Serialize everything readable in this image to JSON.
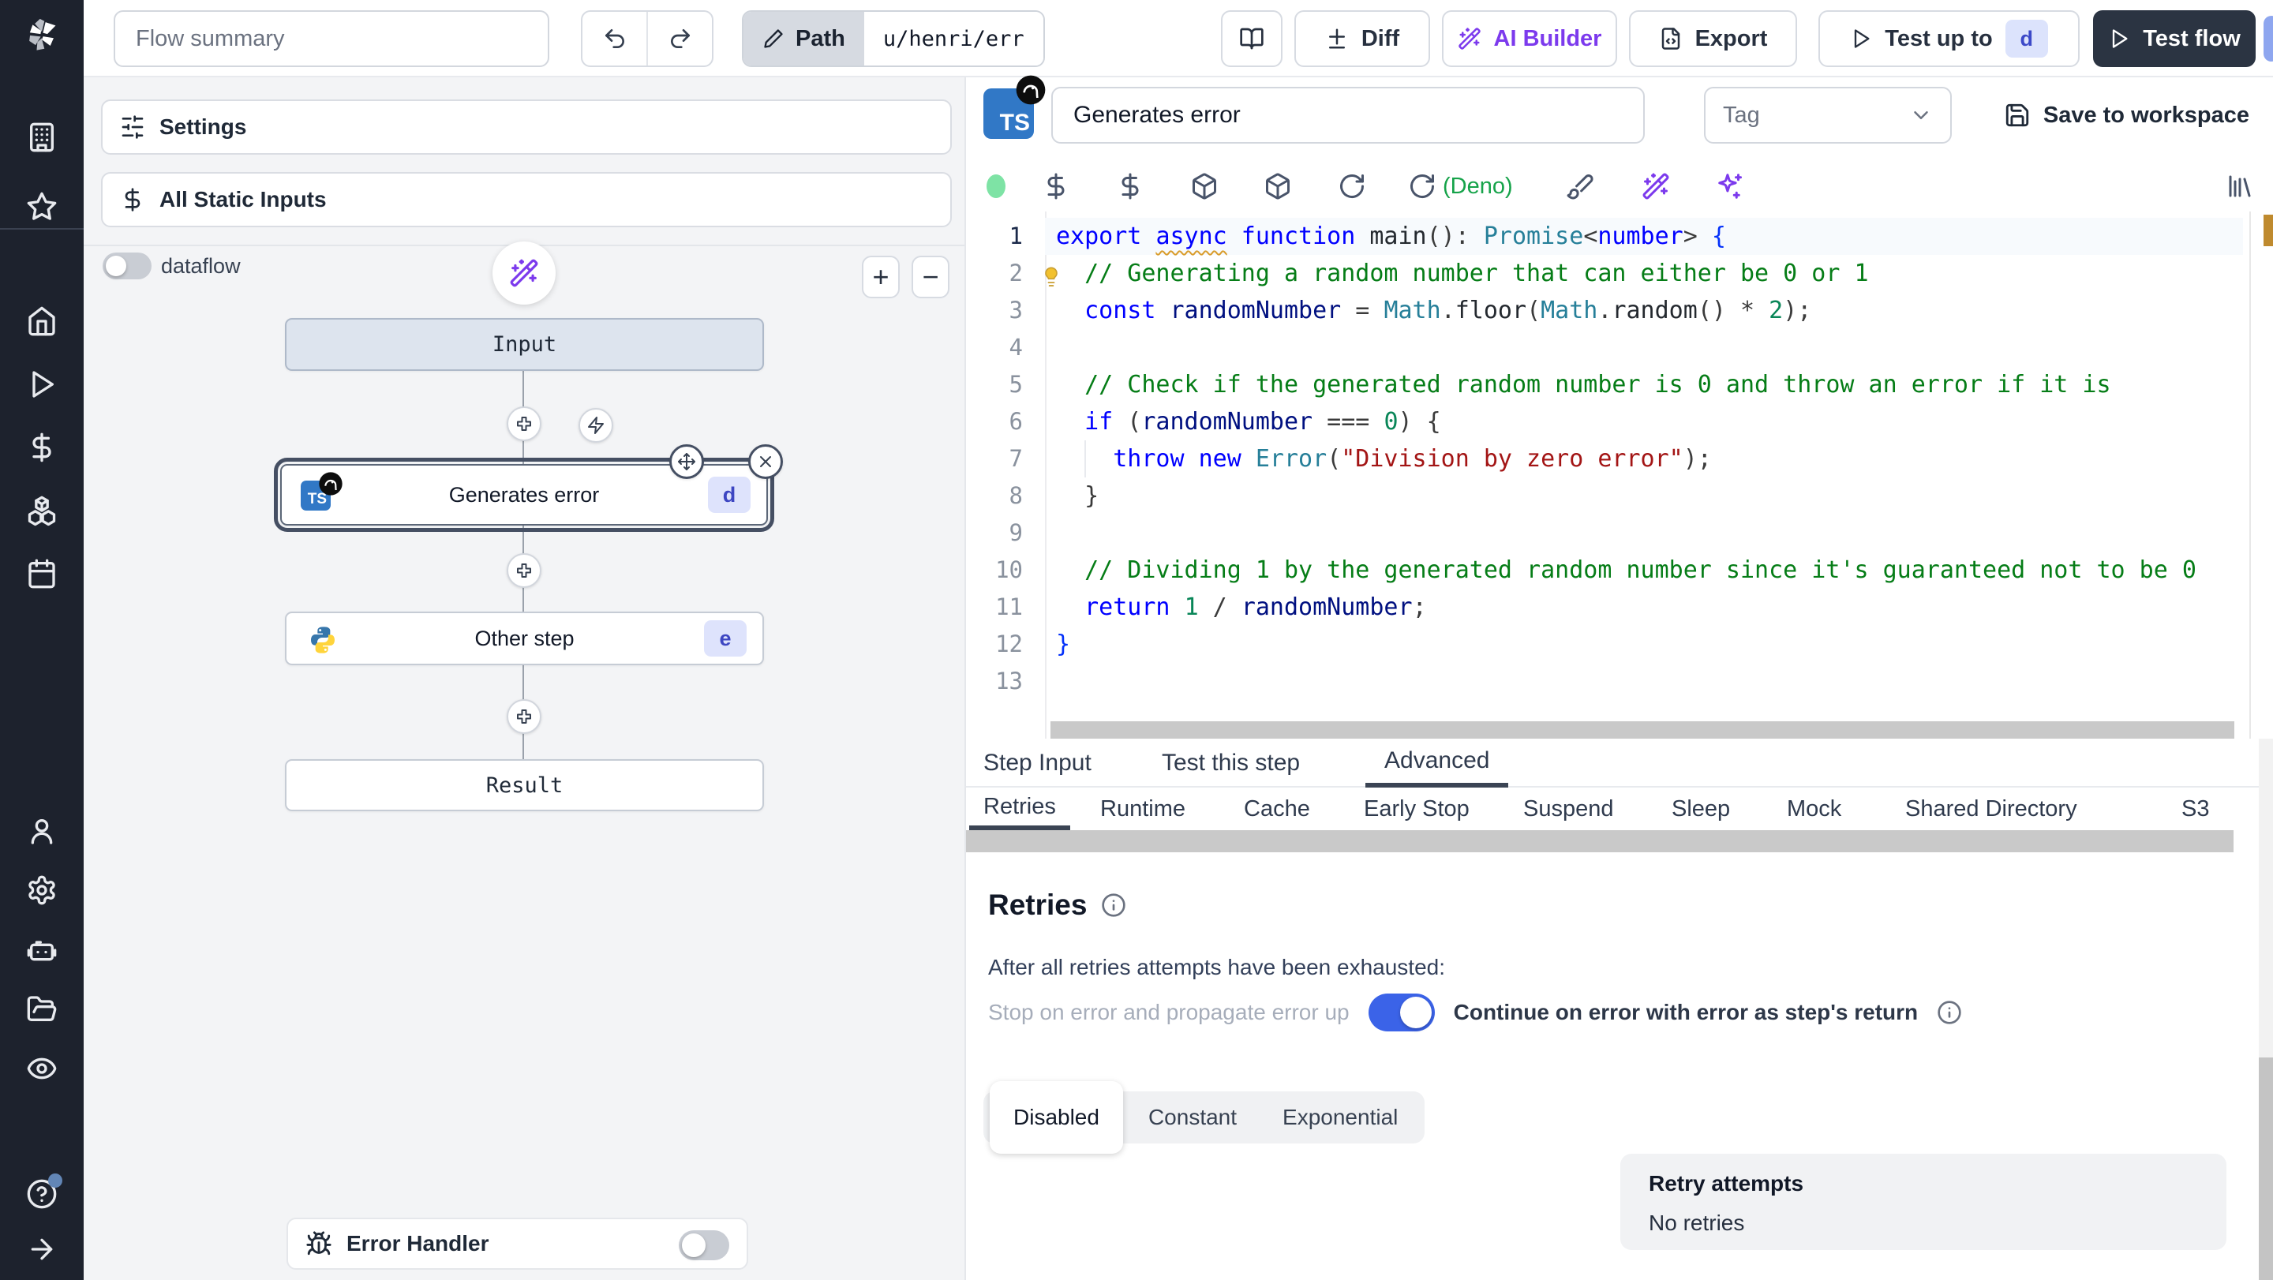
{
  "topbar": {
    "flow_summary_placeholder": "Flow summary",
    "path_label": "Path",
    "path_value": "u/henri/err",
    "diff_label": "Diff",
    "ai_builder_label": "AI Builder",
    "export_label": "Export",
    "test_up_to_label": "Test up to",
    "test_up_to_badge": "d",
    "test_flow_label": "Test flow"
  },
  "flow_panel": {
    "settings_label": "Settings",
    "static_inputs_label": "All Static Inputs",
    "dataflow_label": "dataflow",
    "zoom_in_label": "+",
    "zoom_out_label": "−",
    "input_node_label": "Input",
    "step1_label": "Generates error",
    "step1_badge": "d",
    "step2_label": "Other step",
    "step2_badge": "e",
    "result_node_label": "Result",
    "error_handler_label": "Error Handler"
  },
  "step_editor": {
    "lang_badge": "TS",
    "name_value": "Generates error",
    "tag_placeholder": "Tag",
    "save_label": "Save to workspace",
    "runtime_label": "(Deno)"
  },
  "tabs": {
    "items": [
      "Step Input",
      "Test this step",
      "Advanced"
    ],
    "active": "Advanced"
  },
  "subtabs": {
    "items": [
      "Retries",
      "Runtime",
      "Cache",
      "Early Stop",
      "Suspend",
      "Sleep",
      "Mock",
      "Shared Directory",
      "S3"
    ],
    "active": "Retries"
  },
  "retries": {
    "title": "Retries",
    "exhausted_text": "After all retries attempts have been exhausted:",
    "toggle_off_label": "Stop on error and propagate error up",
    "toggle_on_label": "Continue on error with error as step's return",
    "toggle_state": "on"
  },
  "backoff": {
    "options": [
      "Disabled",
      "Constant",
      "Exponential"
    ],
    "selected": "Disabled"
  },
  "retry_summary": {
    "title": "Retry attempts",
    "value": "No retries"
  },
  "colors": {
    "toggle_blue": "#3b63e8",
    "ai_purple": "#7c3aed",
    "deno_green": "#16a34a",
    "badge_bg": "#dce3fc",
    "badge_text": "#3c49c8",
    "ts_blue": "#3178c6"
  },
  "code": {
    "line_count": 13,
    "lines": [
      [
        [
          "kw",
          "export "
        ],
        [
          "warn",
          "async"
        ],
        [
          "kw",
          " function "
        ],
        [
          "fn",
          "main"
        ],
        [
          "p",
          "(): "
        ],
        [
          "type",
          "Promise"
        ],
        [
          "p",
          "<"
        ],
        [
          "kw",
          "number"
        ],
        [
          "p",
          "> "
        ],
        [
          "b1",
          "{"
        ]
      ],
      [
        [
          "p",
          "  "
        ],
        [
          "cm",
          "// Generating a random number that can either be 0 or 1"
        ]
      ],
      [
        [
          "p",
          "  "
        ],
        [
          "kw",
          "const "
        ],
        [
          "vr",
          "randomNumber"
        ],
        [
          "p",
          " = "
        ],
        [
          "type",
          "Math"
        ],
        [
          "p",
          "."
        ],
        [
          "fn",
          "floor"
        ],
        [
          "p",
          "("
        ],
        [
          "type",
          "Math"
        ],
        [
          "p",
          "."
        ],
        [
          "fn",
          "random"
        ],
        [
          "p",
          "() * "
        ],
        [
          "num",
          "2"
        ],
        [
          "p",
          ");"
        ]
      ],
      [],
      [
        [
          "p",
          "  "
        ],
        [
          "cm",
          "// Check if the generated random number is 0 and throw an error if it is"
        ]
      ],
      [
        [
          "p",
          "  "
        ],
        [
          "kw",
          "if"
        ],
        [
          "p",
          " ("
        ],
        [
          "vr",
          "randomNumber"
        ],
        [
          "p",
          " === "
        ],
        [
          "num",
          "0"
        ],
        [
          "p",
          ") {"
        ]
      ],
      [
        [
          "p",
          "    "
        ],
        [
          "kw",
          "throw"
        ],
        [
          "p",
          " "
        ],
        [
          "kw",
          "new"
        ],
        [
          "p",
          " "
        ],
        [
          "type",
          "Error"
        ],
        [
          "p",
          "("
        ],
        [
          "str",
          "\"Division by zero error\""
        ],
        [
          "p",
          ");"
        ]
      ],
      [
        [
          "p",
          "  }"
        ]
      ],
      [],
      [
        [
          "p",
          "  "
        ],
        [
          "cm",
          "// Dividing 1 by the generated random number since it's guaranteed not to be 0"
        ]
      ],
      [
        [
          "p",
          "  "
        ],
        [
          "kw",
          "return"
        ],
        [
          "p",
          " "
        ],
        [
          "num",
          "1"
        ],
        [
          "p",
          " / "
        ],
        [
          "vr",
          "randomNumber"
        ],
        [
          "p",
          ";"
        ]
      ],
      [
        [
          "b1",
          "}"
        ]
      ],
      []
    ]
  }
}
